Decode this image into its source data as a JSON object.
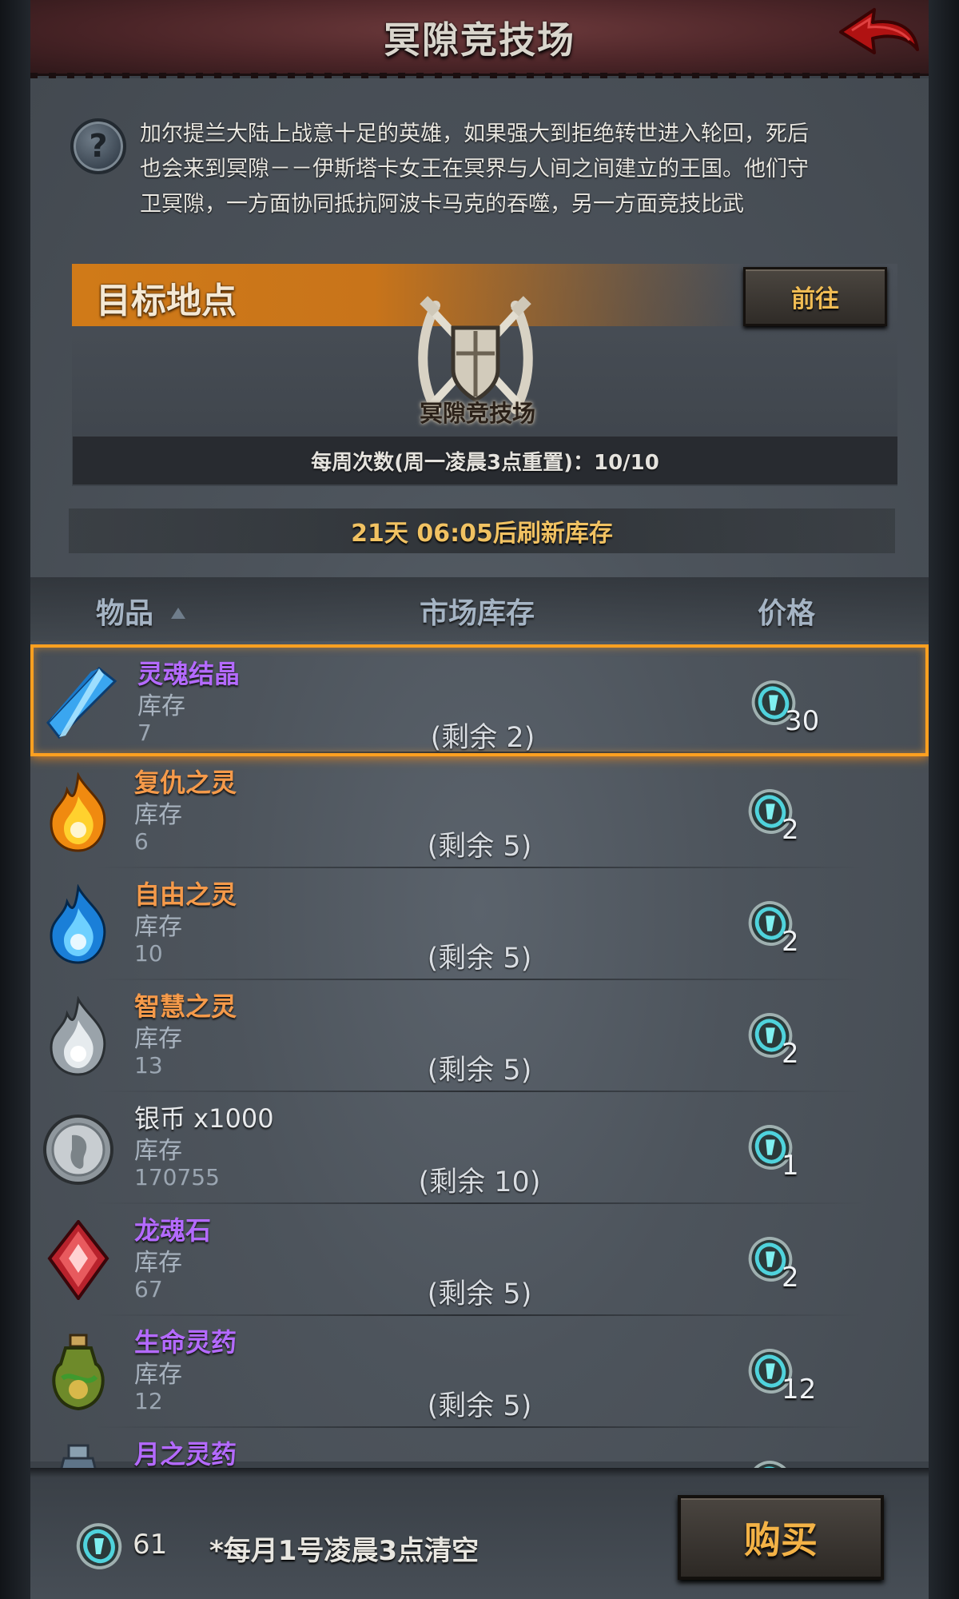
{
  "header": {
    "title": "冥隙竞技场"
  },
  "intro": {
    "text": "加尔提兰大陆上战意十足的英雄，如果强大到拒绝转世进入轮回，死后也会来到冥隙－－伊斯塔卡女王在冥界与人间之间建立的王国。他们守卫冥隙，一方面协同抵抗阿波卡马克的吞噬，另一方面竞技比武"
  },
  "target": {
    "label": "目标地点",
    "goto_label": "前往",
    "location_name": "冥隙竞技场",
    "weekly_count": "每周次数(周一凌晨3点重置)：10/10"
  },
  "shop": {
    "refresh_text": "21天 06:05后刷新库存",
    "columns": {
      "item": "物品",
      "stock": "市场库存",
      "price": "价格"
    },
    "items": [
      {
        "name": "灵魂结晶",
        "name_color": "#b46aff",
        "stock_label": "库存",
        "stock": "7",
        "remaining": "(剩余 2)",
        "price": "30",
        "icon": "soul-crystal-icon"
      },
      {
        "name": "复仇之灵",
        "name_color": "#f59a4a",
        "stock_label": "库存",
        "stock": "6",
        "remaining": "(剩余 5)",
        "price": "2",
        "icon": "fire-spirit-icon"
      },
      {
        "name": "自由之灵",
        "name_color": "#f59a4a",
        "stock_label": "库存",
        "stock": "10",
        "remaining": "(剩余 5)",
        "price": "2",
        "icon": "blue-spirit-icon"
      },
      {
        "name": "智慧之灵",
        "name_color": "#f59a4a",
        "stock_label": "库存",
        "stock": "13",
        "remaining": "(剩余 5)",
        "price": "2",
        "icon": "white-spirit-icon"
      },
      {
        "name": "银币 x1000",
        "name_color": "#e8eaec",
        "stock_label": "库存",
        "stock": "170755",
        "remaining": "(剩余 10)",
        "price": "1",
        "icon": "silver-coin-icon"
      },
      {
        "name": "龙魂石",
        "name_color": "#b46aff",
        "stock_label": "库存",
        "stock": "67",
        "remaining": "(剩余 5)",
        "price": "2",
        "icon": "dragon-soul-stone-icon"
      },
      {
        "name": "生命灵药",
        "name_color": "#b46aff",
        "stock_label": "库存",
        "stock": "12",
        "remaining": "(剩余 5)",
        "price": "12",
        "icon": "life-potion-icon"
      },
      {
        "name": "月之灵药",
        "name_color": "#b46aff",
        "stock_label": "库存",
        "stock": "",
        "remaining": "",
        "price": "",
        "icon": "moon-potion-icon"
      }
    ]
  },
  "footer": {
    "balance": "61",
    "note": "*每月1号凌晨3点清空",
    "buy_label": "购买"
  }
}
